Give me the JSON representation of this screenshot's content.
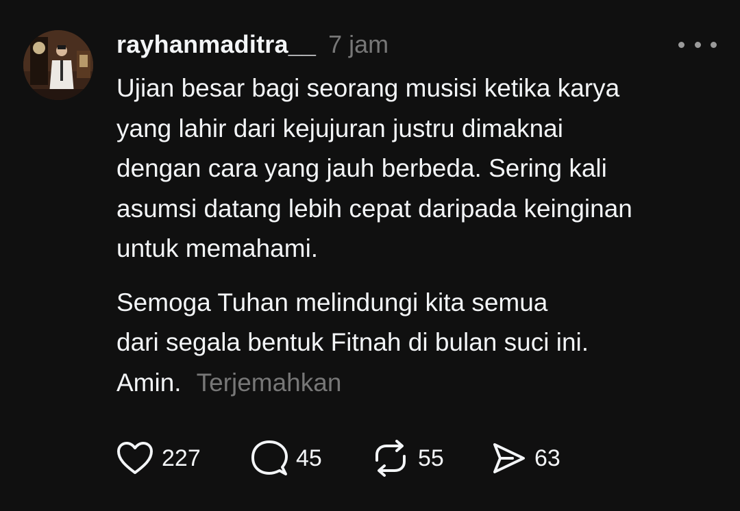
{
  "post": {
    "username": "rayhanmaditra__",
    "timestamp": "7 jam",
    "body_lines": [
      "Ujian besar bagi seorang musisi ketika karya",
      "yang lahir dari kejujuran justru dimaknai",
      "dengan cara yang jauh berbeda. Sering kali",
      "asumsi datang lebih cepat daripada keinginan",
      "untuk memahami."
    ],
    "body_lines_2": [
      "Semoga Tuhan melindungi kita semua",
      "dari segala bentuk Fitnah di bulan suci ini.",
      "Amin."
    ],
    "translate_label": "Terjemahkan"
  },
  "actions": {
    "like_count": "227",
    "comment_count": "45",
    "repost_count": "55",
    "share_count": "63"
  },
  "icons": {
    "more": "more-horizontal-icon",
    "like": "heart-icon",
    "comment": "speech-bubble-icon",
    "repost": "repost-arrows-icon",
    "share": "send-icon"
  },
  "colors": {
    "background": "#101010",
    "text_primary": "#f3f5f7",
    "text_secondary": "#777777"
  }
}
